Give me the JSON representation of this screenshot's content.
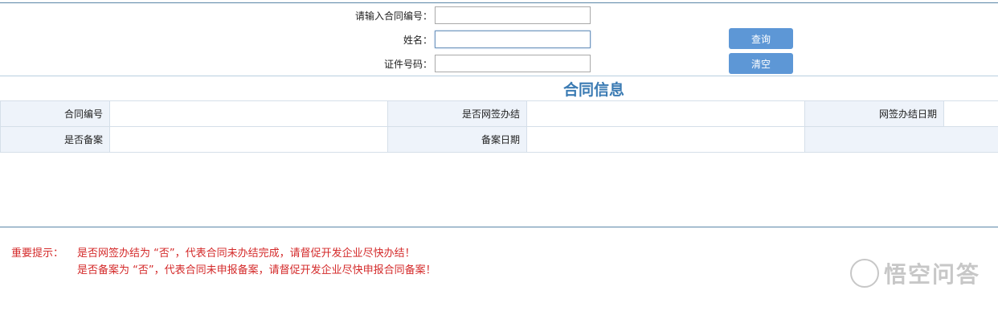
{
  "search_form": {
    "contract_no_label": "请输入合同编号：",
    "contract_no_value": "",
    "name_label": "姓名：",
    "name_value": "",
    "id_no_label": "证件号码：",
    "id_no_value": "",
    "query_button": "查询",
    "clear_button": "清空"
  },
  "contract_info": {
    "title": "合同信息",
    "rows": [
      [
        {
          "label": "合同编号",
          "value": ""
        },
        {
          "label": "是否网签办结",
          "value": ""
        },
        {
          "label": "网签办结日期",
          "value": ""
        }
      ],
      [
        {
          "label": "是否备案",
          "value": ""
        },
        {
          "label": "备案日期",
          "value": ""
        },
        {
          "label": "",
          "value": ""
        }
      ]
    ]
  },
  "notice": {
    "prefix": "重要提示：",
    "lines": [
      "是否网签办结为 “否”，代表合同未办结完成，请督促开发企业尽快办结！",
      "是否备案为 “否”，代表合同未申报备案，请督促开发企业尽快申报合同备案！"
    ]
  },
  "watermark": {
    "logo_glyph": "",
    "text": "悟空问答",
    "icon": "speech-bubble-icon"
  }
}
